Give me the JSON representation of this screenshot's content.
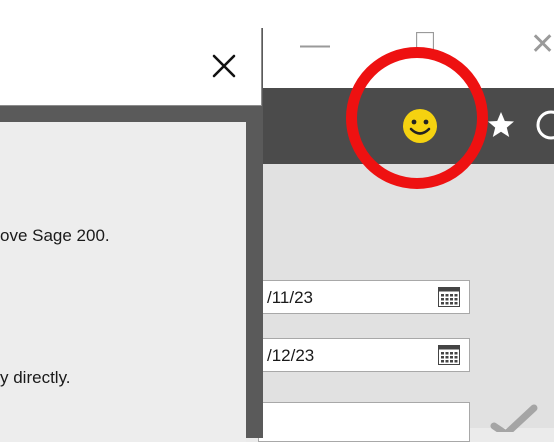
{
  "window": {
    "minimize_glyph": "—",
    "maximize_glyph": "□",
    "close_glyph": "✕"
  },
  "toolbar": {
    "icons": [
      "smiley-icon",
      "star-icon",
      "clock-icon"
    ]
  },
  "form": {
    "dates": [
      {
        "value": "/11/23"
      },
      {
        "value": "/12/23"
      }
    ]
  },
  "dialog": {
    "close_glyph": "✕",
    "lines": [
      "ove Sage 200.",
      "y directly."
    ]
  },
  "colors": {
    "annotation": "#ee1111",
    "toolbar": "#4b4b4b",
    "smiley": "#f5d210"
  }
}
